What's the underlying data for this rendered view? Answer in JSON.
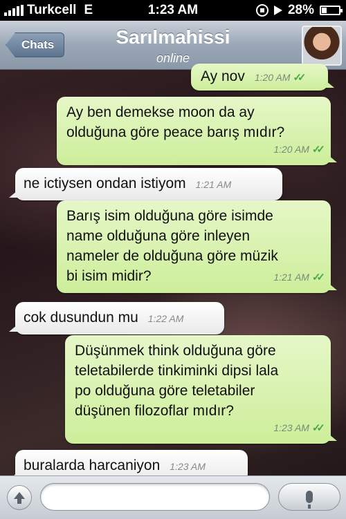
{
  "status_bar": {
    "carrier": "Turkcell",
    "network": "E",
    "time": "1:23 AM",
    "battery": "28%",
    "battery_level": 0.28
  },
  "nav": {
    "back_label": "Chats",
    "contact_name": "Sarılmahissi",
    "contact_status": "online"
  },
  "messages": [
    {
      "direction": "out",
      "lines": [
        "Ay nov"
      ],
      "time": "1:20 AM",
      "ticks": "✓✓"
    },
    {
      "direction": "out",
      "lines": [
        "Ay ben demekse moon da ay",
        "olduğuna göre peace barış mıdır?"
      ],
      "time": "1:20 AM",
      "ticks": "✓✓"
    },
    {
      "direction": "in",
      "lines": [
        "ne ictiysen ondan istiyom"
      ],
      "time": "1:21 AM"
    },
    {
      "direction": "out",
      "lines": [
        "Barış isim olduğuna göre isimde",
        "name olduğuna göre inleyen",
        "nameler de olduğuna göre müzik",
        "bi isim midir?"
      ],
      "time": "1:21 AM",
      "ticks": "✓✓"
    },
    {
      "direction": "in",
      "lines": [
        "cok dusundun mu"
      ],
      "time": "1:22 AM"
    },
    {
      "direction": "out",
      "lines": [
        "Düşünmek think olduğuna göre",
        "teletabilerde tinkiminki dipsi lala",
        "po olduğuna göre teletabiler",
        "düşünen filozoflar mıdır?"
      ],
      "time": "1:23 AM",
      "ticks": "✓✓"
    },
    {
      "direction": "in",
      "lines": [
        "buralarda harcaniyon"
      ],
      "time": "1:23 AM"
    }
  ],
  "input": {
    "placeholder": ""
  }
}
